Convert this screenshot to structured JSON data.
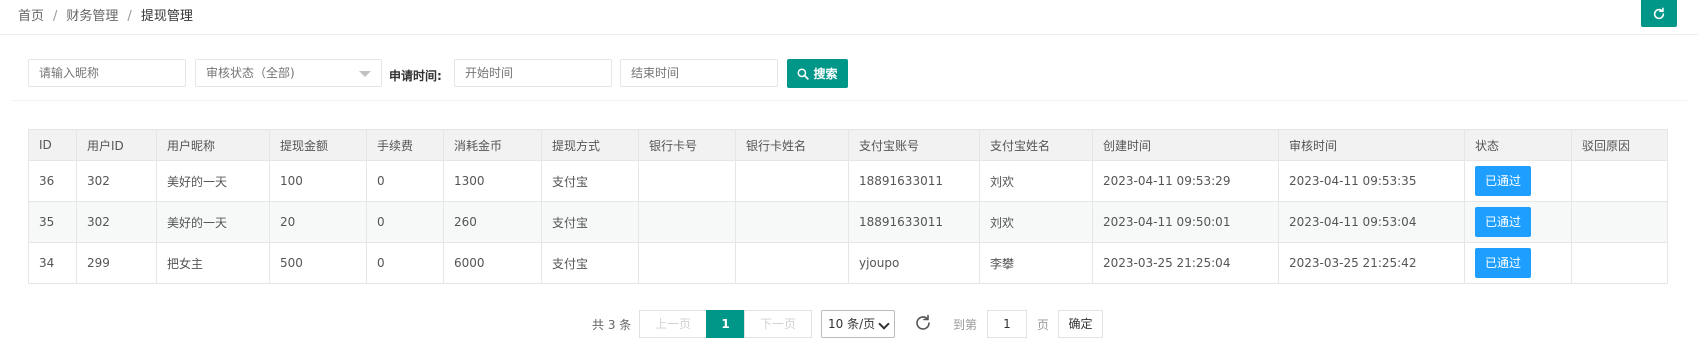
{
  "breadcrumb": {
    "home": "首页",
    "sep": "/",
    "section": "财务管理",
    "current": "提现管理"
  },
  "filters": {
    "nickname_placeholder": "请输入昵称",
    "status_select": "审核状态（全部)",
    "time_label": "申请时间:",
    "start_placeholder": "开始时间",
    "end_placeholder": "结束时间",
    "search_label": "搜索"
  },
  "table": {
    "columns": [
      "ID",
      "用户ID",
      "用户昵称",
      "提现金额",
      "手续费",
      "消耗金币",
      "提现方式",
      "银行卡号",
      "银行卡姓名",
      "支付宝账号",
      "支付宝姓名",
      "创建时间",
      "审核时间",
      "状态",
      "驳回原因"
    ],
    "rows": [
      [
        "36",
        "302",
        "美好的一天",
        "100",
        "0",
        "1300",
        "支付宝",
        "",
        "",
        "18891633011",
        "刘欢",
        "2023-04-11 09:53:29",
        "2023-04-11 09:53:35",
        "已通过",
        ""
      ],
      [
        "35",
        "302",
        "美好的一天",
        "20",
        "0",
        "260",
        "支付宝",
        "",
        "",
        "18891633011",
        "刘欢",
        "2023-04-11 09:50:01",
        "2023-04-11 09:53:04",
        "已通过",
        ""
      ],
      [
        "34",
        "299",
        "把女主",
        "500",
        "0",
        "6000",
        "支付宝",
        "",
        "",
        "yjoupo",
        "李攀",
        "2023-03-25 21:25:04",
        "2023-03-25 21:25:42",
        "已通过",
        ""
      ]
    ]
  },
  "pagination": {
    "total": "共 3 条",
    "prev": "上一页",
    "current": "1",
    "next": "下一页",
    "page_size": "10 条/页",
    "goto_label": "到第",
    "goto_value": "1",
    "page_unit": "页",
    "confirm": "确定"
  },
  "colors": {
    "primary": "#009688",
    "badge": "#1e9fff"
  }
}
